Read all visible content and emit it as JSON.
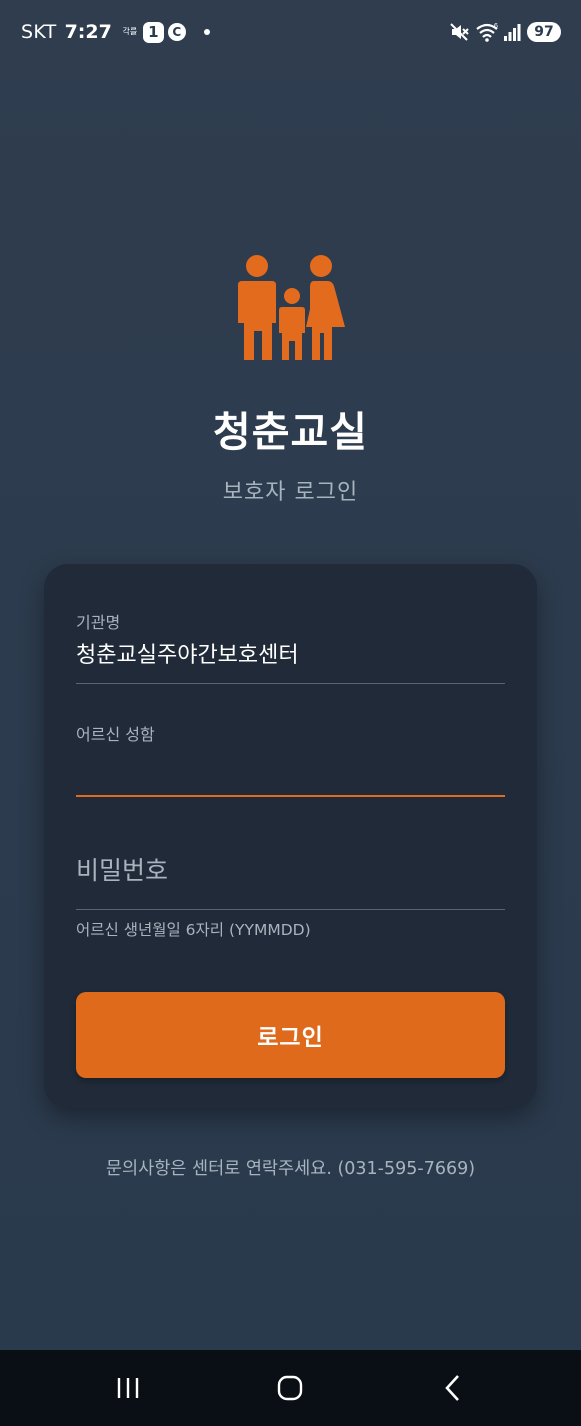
{
  "status_bar": {
    "carrier": "SKT",
    "time": "7:27",
    "small_label": "각를",
    "notification_count": "1",
    "c_badge": "C",
    "battery": "97",
    "icons": [
      "mute-icon",
      "wifi-icon",
      "signal-icon"
    ]
  },
  "app": {
    "title": "청춘교실",
    "subtitle": "보호자 로그인",
    "logo_icon": "family-icon"
  },
  "form": {
    "org": {
      "label": "기관명",
      "value": "청춘교실주야간보호센터"
    },
    "name": {
      "label": "어르신 성함",
      "value": ""
    },
    "password": {
      "placeholder": "비밀번호",
      "helper": "어르신 생년월일 6자리 (YYMMDD)"
    },
    "login_label": "로그인"
  },
  "contact_text": "문의사항은 센터로 연락주세요. (031-595-7669)",
  "nav": {
    "icons": [
      "recents-icon",
      "home-icon",
      "back-icon"
    ]
  },
  "colors": {
    "background": "#2c3b4d",
    "card": "#202a38",
    "accent": "#df6a1c",
    "muted_text": "#a9b2bd"
  }
}
